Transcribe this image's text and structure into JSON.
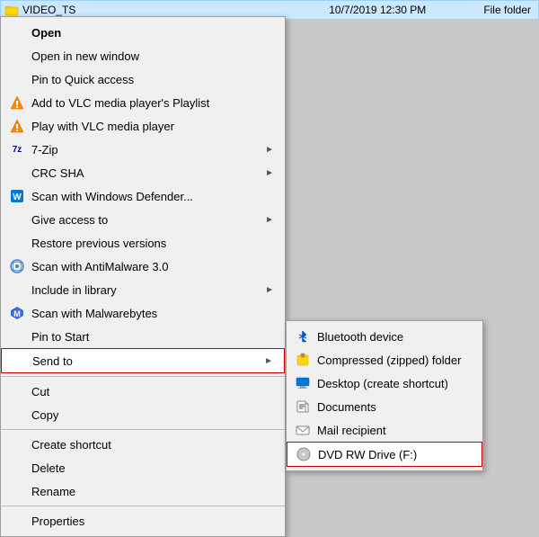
{
  "fileRow": {
    "name": "VIDEO_TS",
    "date": "10/7/2019 12:30 PM",
    "type": "File folder"
  },
  "contextMenu": {
    "items": [
      {
        "id": "open",
        "label": "Open",
        "icon": null,
        "hasArrow": false,
        "separator": false,
        "bold": true
      },
      {
        "id": "open-new-window",
        "label": "Open in new window",
        "icon": null,
        "hasArrow": false,
        "separator": false
      },
      {
        "id": "pin-quick-access",
        "label": "Pin to Quick access",
        "icon": null,
        "hasArrow": false,
        "separator": false
      },
      {
        "id": "vlc-playlist",
        "label": "Add to VLC media player's Playlist",
        "icon": "vlc",
        "hasArrow": false,
        "separator": false
      },
      {
        "id": "vlc-play",
        "label": "Play with VLC media player",
        "icon": "vlc",
        "hasArrow": false,
        "separator": false
      },
      {
        "id": "7zip",
        "label": "7-Zip",
        "icon": "7zip",
        "hasArrow": true,
        "separator": false
      },
      {
        "id": "crcsha",
        "label": "CRC SHA",
        "icon": null,
        "hasArrow": true,
        "separator": false
      },
      {
        "id": "defender",
        "label": "Scan with Windows Defender...",
        "icon": "defender",
        "hasArrow": false,
        "separator": false
      },
      {
        "id": "give-access",
        "label": "Give access to",
        "icon": null,
        "hasArrow": true,
        "separator": false
      },
      {
        "id": "restore-versions",
        "label": "Restore previous versions",
        "icon": null,
        "hasArrow": false,
        "separator": false
      },
      {
        "id": "antimalware",
        "label": "Scan with AntiMalware 3.0",
        "icon": "antimalware",
        "hasArrow": false,
        "separator": false
      },
      {
        "id": "include-library",
        "label": "Include in library",
        "icon": null,
        "hasArrow": true,
        "separator": false
      },
      {
        "id": "malwarebytes",
        "label": "Scan with Malwarebytes",
        "icon": "malwarebytes",
        "hasArrow": false,
        "separator": false
      },
      {
        "id": "pin-start",
        "label": "Pin to Start",
        "icon": null,
        "hasArrow": false,
        "separator": false
      },
      {
        "id": "send-to",
        "label": "Send to",
        "icon": null,
        "hasArrow": true,
        "separator": false,
        "highlighted": true
      },
      {
        "id": "sep1",
        "label": "",
        "icon": null,
        "hasArrow": false,
        "separator": true
      },
      {
        "id": "cut",
        "label": "Cut",
        "icon": null,
        "hasArrow": false,
        "separator": false
      },
      {
        "id": "copy",
        "label": "Copy",
        "icon": null,
        "hasArrow": false,
        "separator": false
      },
      {
        "id": "sep2",
        "label": "",
        "icon": null,
        "hasArrow": false,
        "separator": true
      },
      {
        "id": "create-shortcut",
        "label": "Create shortcut",
        "icon": null,
        "hasArrow": false,
        "separator": false
      },
      {
        "id": "delete",
        "label": "Delete",
        "icon": null,
        "hasArrow": false,
        "separator": false
      },
      {
        "id": "rename",
        "label": "Rename",
        "icon": null,
        "hasArrow": false,
        "separator": false
      },
      {
        "id": "sep3",
        "label": "",
        "icon": null,
        "hasArrow": false,
        "separator": true
      },
      {
        "id": "properties",
        "label": "Properties",
        "icon": null,
        "hasArrow": false,
        "separator": false
      }
    ]
  },
  "submenu": {
    "items": [
      {
        "id": "bluetooth",
        "label": "Bluetooth device",
        "icon": "bluetooth",
        "highlighted": false
      },
      {
        "id": "compressed",
        "label": "Compressed (zipped) folder",
        "icon": "compressed",
        "highlighted": false
      },
      {
        "id": "desktop",
        "label": "Desktop (create shortcut)",
        "icon": "desktop",
        "highlighted": false
      },
      {
        "id": "documents",
        "label": "Documents",
        "icon": "documents",
        "highlighted": false
      },
      {
        "id": "mail",
        "label": "Mail recipient",
        "icon": "mail",
        "highlighted": false
      },
      {
        "id": "dvd",
        "label": "DVD RW Drive (F:)",
        "icon": "dvd",
        "highlighted": true
      }
    ]
  }
}
